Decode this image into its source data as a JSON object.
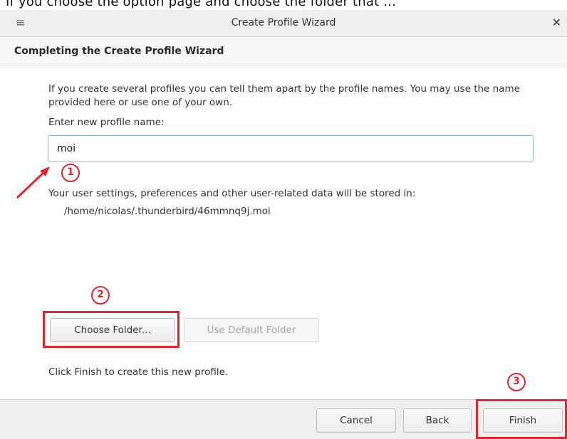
{
  "top_crop_text": "If you choose the option page and choose the folder that ...",
  "window": {
    "title": "Create Profile Wizard",
    "menu_icon": "hamburger-menu-icon",
    "close_icon": "close-icon"
  },
  "header": {
    "title": "Completing the Create Profile Wizard"
  },
  "content": {
    "intro": "If you create several profiles you can tell them apart by the profile names. You may use the name provided here or use one of your own.",
    "prompt_label": "Enter new profile name:",
    "profile_name_value": "moi",
    "storage_text": "Your user settings, preferences and other user-related data will be stored in:",
    "storage_path": "/home/nicolas/.thunderbird/46mmnq9j.moi",
    "choose_folder_label": "Choose Folder...",
    "use_default_folder_label": "Use Default Folder",
    "finish_hint": "Click Finish to create this new profile."
  },
  "footer": {
    "cancel_label": "Cancel",
    "back_label": "Back",
    "finish_label": "Finish"
  },
  "annotations": {
    "marker_1": "1",
    "marker_2": "2",
    "marker_3": "3",
    "color": "#e2262d"
  }
}
